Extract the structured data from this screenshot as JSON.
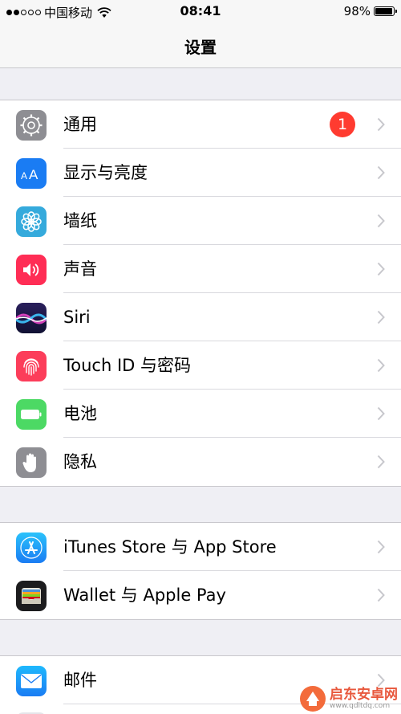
{
  "status_bar": {
    "carrier": "中国移动",
    "time": "08:41",
    "battery_percent": "98%",
    "battery_level": 0.98,
    "signal_bars_filled": 2,
    "signal_bars_total": 5
  },
  "nav": {
    "title": "设置"
  },
  "groups": [
    {
      "items": [
        {
          "label": "通用",
          "icon": "gear-icon",
          "icon_color": "#8e8e93",
          "badge": "1"
        },
        {
          "label": "显示与亮度",
          "icon": "display-brightness-icon",
          "icon_color": "#1a7cf3"
        },
        {
          "label": "墙纸",
          "icon": "wallpaper-flower-icon",
          "icon_color": "#35aadc"
        },
        {
          "label": "声音",
          "icon": "speaker-icon",
          "icon_color": "#ff2d55"
        },
        {
          "label": "Siri",
          "icon": "siri-icon",
          "icon_color": "#1c1c3c"
        },
        {
          "label": "Touch ID 与密码",
          "icon": "fingerprint-icon",
          "icon_color": "#fc3d5a"
        },
        {
          "label": "电池",
          "icon": "battery-icon",
          "icon_color": "#4cd964"
        },
        {
          "label": "隐私",
          "icon": "hand-icon",
          "icon_color": "#8e8e93"
        }
      ]
    },
    {
      "items": [
        {
          "label": "iTunes Store 与 App Store",
          "icon": "app-store-icon",
          "icon_color": "#1aa3ef"
        },
        {
          "label": "Wallet 与 Apple Pay",
          "icon": "wallet-icon",
          "icon_color": "#1c1c1e"
        }
      ]
    },
    {
      "items": [
        {
          "label": "邮件",
          "icon": "mail-icon",
          "icon_color": "#2196f3"
        }
      ]
    }
  ],
  "watermark": {
    "main": "启东安卓网",
    "sub": "www.qdltdq.com"
  }
}
